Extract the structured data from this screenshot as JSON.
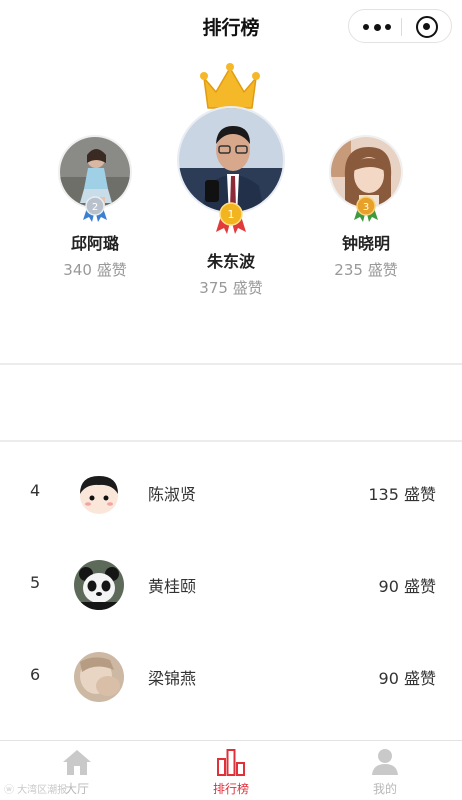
{
  "header": {
    "title": "排行榜"
  },
  "podium": [
    {
      "position": "second",
      "rank": "2",
      "name": "邱阿璐",
      "likes": "340 盛赞",
      "medal_color": "#b9c2cc"
    },
    {
      "position": "first",
      "rank": "1",
      "name": "朱东波",
      "likes": "375 盛赞",
      "medal_color": "#f2b51f"
    },
    {
      "position": "third",
      "rank": "3",
      "name": "钟晓明",
      "likes": "235 盛赞",
      "medal_color": "#e7a12a"
    }
  ],
  "list": [
    {
      "rank": "4",
      "name": "陈淑贤",
      "likes": "135 盛赞"
    },
    {
      "rank": "5",
      "name": "黄桂颐",
      "likes": "90 盛赞"
    },
    {
      "rank": "6",
      "name": "梁锦燕",
      "likes": "90 盛赞"
    }
  ],
  "tabbar": {
    "tabs": [
      {
        "label": "大厅",
        "icon": "home-icon"
      },
      {
        "label": "排行榜",
        "icon": "ranking-icon",
        "active": true
      },
      {
        "label": "我的",
        "icon": "user-icon"
      }
    ],
    "accent": "#e0303a"
  },
  "watermark": "ⓦ 大湾区潮报"
}
